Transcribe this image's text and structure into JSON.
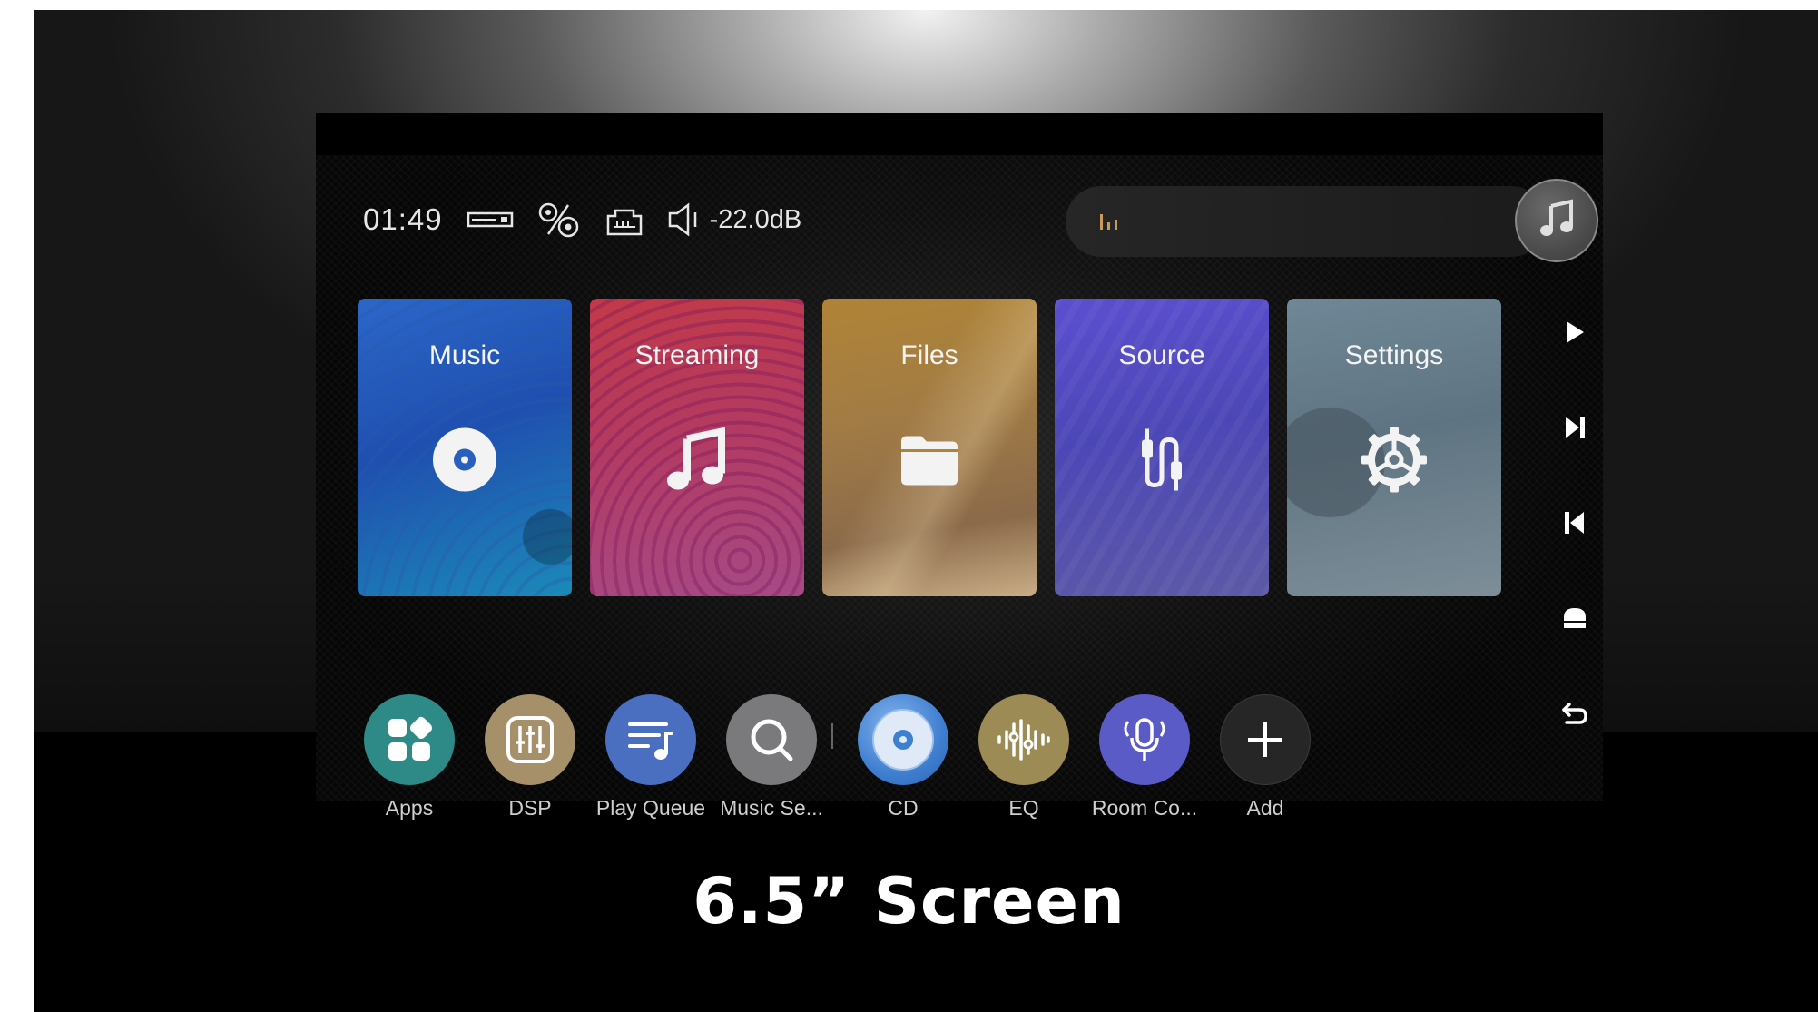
{
  "status": {
    "time": "01:49",
    "volume": "-22.0dB",
    "icons": [
      "usb-dac-icon",
      "digital-output-icon",
      "network-icon",
      "speaker-icon"
    ]
  },
  "now_playing": {
    "icon": "music-note-icon"
  },
  "tiles": [
    {
      "label": "Music",
      "icon": "disc-icon",
      "color": "#2b67c9"
    },
    {
      "label": "Streaming",
      "icon": "music-note-icon",
      "color": "#c23a48"
    },
    {
      "label": "Files",
      "icon": "folder-icon",
      "color": "#b08436"
    },
    {
      "label": "Source",
      "icon": "cable-icon",
      "color": "#5c4fd0"
    },
    {
      "label": "Settings",
      "icon": "gear-icon",
      "color": "#6f8796"
    }
  ],
  "apps": [
    {
      "label": "Apps",
      "icon": "apps-grid-icon",
      "color": "#2e8a86"
    },
    {
      "label": "DSP",
      "icon": "sliders-icon",
      "color": "#a5906a"
    },
    {
      "label": "Play Queue",
      "icon": "playlist-icon",
      "color": "#4a6fc0"
    },
    {
      "label": "Music Se...",
      "icon": "search-icon",
      "color": "#7a7a7c"
    },
    {
      "label": "CD",
      "icon": "cd-icon",
      "color": "#3f7fd0"
    },
    {
      "label": "EQ",
      "icon": "equalizer-icon",
      "color": "#9c8b55"
    },
    {
      "label": "Room Co...",
      "icon": "microphone-icon",
      "color": "#5b5bc8"
    },
    {
      "label": "Add",
      "icon": "plus-icon",
      "color": "#262626"
    }
  ],
  "side_controls": [
    "play-icon",
    "next-icon",
    "previous-icon",
    "home-icon",
    "back-icon"
  ],
  "caption": "6.5” Screen"
}
